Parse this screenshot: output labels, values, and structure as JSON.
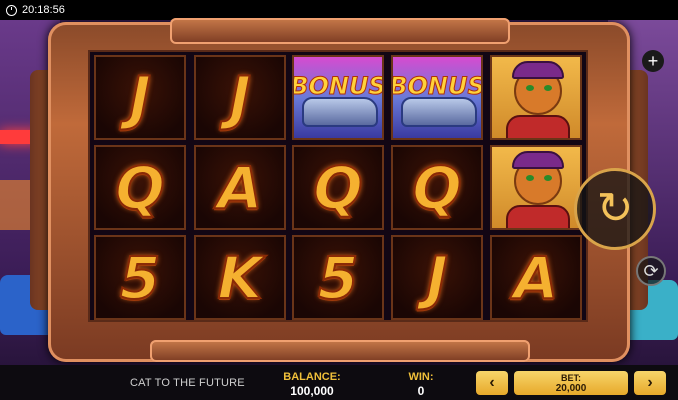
{
  "status": {
    "time": "20:18:56"
  },
  "game": {
    "title": "CAT TO THE FUTURE"
  },
  "reels": [
    [
      "J",
      "Q",
      "5"
    ],
    [
      "J",
      "A",
      "K"
    ],
    [
      "BONUS",
      "Q",
      "5"
    ],
    [
      "BONUS",
      "Q",
      "J"
    ],
    [
      "CAT",
      "CAT",
      "A"
    ]
  ],
  "symbols": {
    "bonus_label": "BONUS"
  },
  "controls": {
    "spin_icon": "↻",
    "plus_icon": "+",
    "autoplay_icon": "⟳",
    "left_arrow": "‹",
    "right_arrow": "›"
  },
  "balance": {
    "label": "BALANCE:",
    "value": "100,000"
  },
  "win": {
    "label": "WIN:",
    "value": "0"
  },
  "bet": {
    "label": "BET:",
    "value": "20,000"
  },
  "colors": {
    "accent": "#f3c25a",
    "symbol": "#f5b130",
    "frame": "#c06a3a"
  }
}
